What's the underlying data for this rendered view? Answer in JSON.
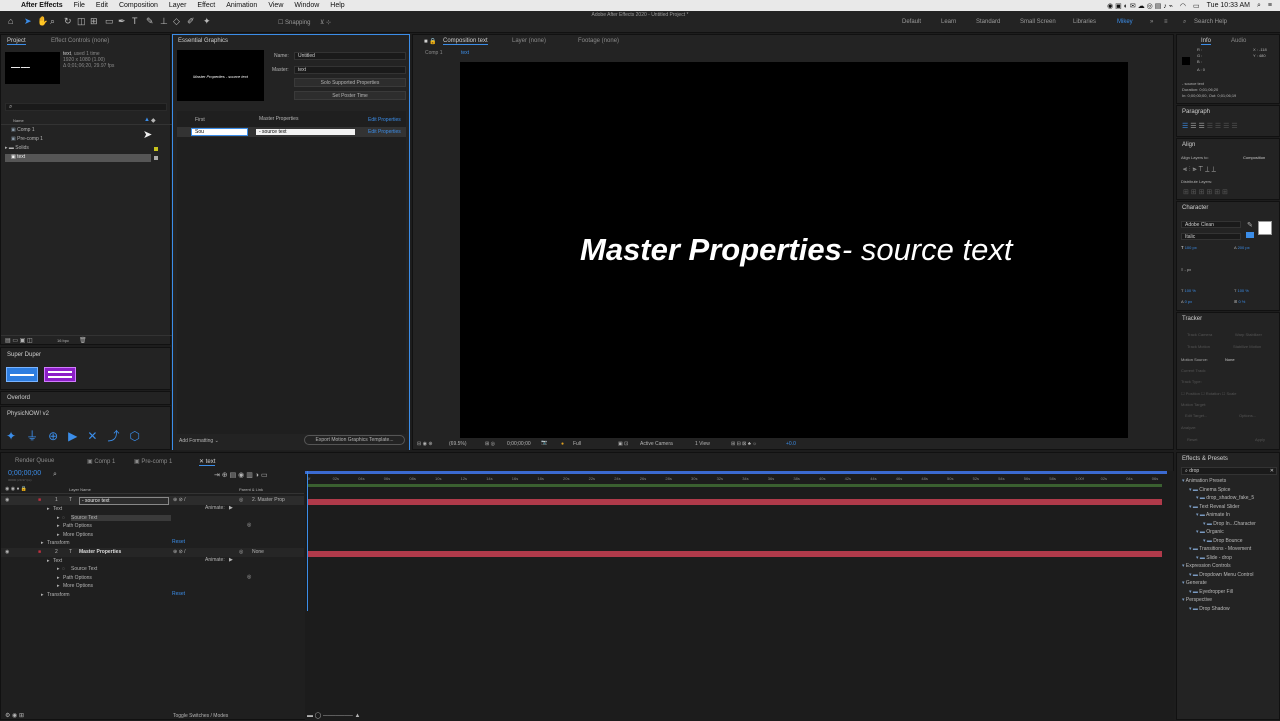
{
  "menubar": {
    "apple": "",
    "app": "After Effects",
    "items": [
      "File",
      "Edit",
      "Composition",
      "Layer",
      "Effect",
      "Animation",
      "View",
      "Window",
      "Help"
    ],
    "clock": "Tue 10:33 AM"
  },
  "window_title": "Adobe After Effects 2020 - Untitled Project *",
  "toolbar": {
    "snapping": "Snapping",
    "workspaces": [
      "Default",
      "Learn",
      "Standard",
      "Small Screen",
      "Libraries",
      "Mikey"
    ],
    "search": "Search Help"
  },
  "project": {
    "tab": "Project",
    "effect_controls": "Effect Controls (none)",
    "item_name": "text",
    "item_used": ", used 1 time",
    "item_dims": "1920 x 1080 (1.00)",
    "item_dur": "Δ 0;01;06;20, 29.97 fps",
    "col_name": "Name",
    "items": [
      "Comp 1",
      "Pre-comp 1",
      "Solids",
      "text"
    ],
    "bpc": "16 bpc"
  },
  "superduper": {
    "title": "Super Duper"
  },
  "overlord": {
    "title": "Overlord"
  },
  "physics": {
    "title": "PhysicNOW! v2"
  },
  "essential": {
    "title": "Essential Graphics",
    "thumb_text": "Master Properties - source text",
    "name_label": "Name:",
    "name_value": "Untitled",
    "master_label": "Master:",
    "master_value": "text",
    "solo_btn": "Solo Supported Properties",
    "poster_btn": "Set Poster Time",
    "col_first": "First",
    "col_master": "Master Properties",
    "edit_props": "Edit Properties",
    "row_input": "Sou",
    "row_master": "- source text",
    "edit_props2": "Edit Properties",
    "add_formatting": "Add Formatting",
    "export_btn": "Export Motion Graphics Template..."
  },
  "comp": {
    "tab": "Composition text",
    "layer_tab": "Layer (none)",
    "footage_tab": "Footage (none)",
    "breadcrumb_root": "Comp 1",
    "breadcrumb_cur": "text",
    "title_bold": "Master Properties",
    "title_rest": "- source text",
    "zoom": "(69.5%)",
    "time": "0;00;00;00",
    "quality": "Full",
    "camera": "Active Camera",
    "view": "1 View",
    "exposure": "+0.0"
  },
  "info": {
    "tabs": [
      "Info",
      "Audio"
    ],
    "x": "X : -118",
    "y": "Y : 480",
    "r": "R :",
    "g": "G :",
    "b": "B :",
    "a": "A : 0",
    "src": "- source text",
    "dur": "Duration: 0;01;06;20",
    "inout": "In: 0;00;00;00, Out: 0;01;06;19"
  },
  "paragraph": {
    "title": "Paragraph"
  },
  "align": {
    "title": "Align",
    "align_to_label": "Align Layers to:",
    "align_to": "Composition",
    "distribute": "Distribute Layers:"
  },
  "character": {
    "title": "Character",
    "font": "Adobe Clean",
    "style": "Italic",
    "size": "100 px",
    "tracking": "200 px",
    "units": "- px",
    "scale_v": "100 %",
    "scale_h": "100 %",
    "baseline": "0 px",
    "tsume": "0 %"
  },
  "tracker": {
    "title": "Tracker",
    "items": [
      "Track Camera",
      "Warp Stabilizer",
      "Track Motion",
      "Stabilize Motion"
    ],
    "motion_source_label": "Motion Source:",
    "motion_source": "None",
    "current_track": "Current Track:",
    "track_type": "Track Type:",
    "position": "Position",
    "rotation": "Rotation",
    "scale": "Scale",
    "motion_target": "Motion Target:",
    "edit_target": "Edit Target...",
    "options": "Options...",
    "analyze": "Analyze:",
    "reset": "Reset",
    "apply": "Apply"
  },
  "effects": {
    "title": "Effects & Presets",
    "search": "drop",
    "tree": [
      {
        "t": "Animation Presets",
        "d": 0
      },
      {
        "t": "Cinema Spice",
        "d": 1
      },
      {
        "t": "drop_shadow_fake_5",
        "d": 2
      },
      {
        "t": "Text Reveal Slider",
        "d": 1
      },
      {
        "t": "Animate In",
        "d": 2
      },
      {
        "t": "Drop In...Character",
        "d": 3
      },
      {
        "t": "Organic",
        "d": 2
      },
      {
        "t": "Drop Bounce",
        "d": 3
      },
      {
        "t": "Transitions - Movement",
        "d": 1
      },
      {
        "t": "Slide - drop",
        "d": 2
      },
      {
        "t": "Expression Controls",
        "d": 0
      },
      {
        "t": "Dropdown Menu Control",
        "d": 1
      },
      {
        "t": "Generate",
        "d": 0
      },
      {
        "t": "Eyedropper Fill",
        "d": 1
      },
      {
        "t": "Perspective",
        "d": 0
      },
      {
        "t": "Drop Shadow",
        "d": 1
      }
    ]
  },
  "timeline": {
    "tabs": [
      "Render Queue",
      "Comp 1",
      "Pre-comp 1",
      "text"
    ],
    "time": "0;00;00;00",
    "fps": "00000 (29.97 fps)",
    "col_layer": "Layer Name",
    "col_parent": "Parent & Link",
    "layers": [
      {
        "num": "1",
        "name": "- source text",
        "parent": "2. Master Prop"
      },
      {
        "num": "2",
        "name": "Master Properties",
        "parent": "None"
      }
    ],
    "props1": [
      "Text",
      "Source Text",
      "Path Options",
      "More Options",
      "Transform"
    ],
    "props2": [
      "Text",
      "Source Text",
      "Path Options",
      "More Options",
      "Transform"
    ],
    "animate": "Animate:",
    "reset": "Reset",
    "ruler": [
      "0f",
      "02s",
      "04s",
      "06s",
      "08s",
      "10s",
      "12s",
      "14s",
      "16s",
      "18s",
      "20s",
      "22s",
      "24s",
      "26s",
      "28s",
      "30s",
      "32s",
      "34s",
      "36s",
      "38s",
      "40s",
      "42s",
      "44s",
      "46s",
      "48s",
      "50s",
      "52s",
      "54s",
      "56s",
      "58s",
      "1:00f",
      "02s",
      "04s",
      "06s"
    ],
    "toggle": "Toggle Switches / Modes"
  }
}
